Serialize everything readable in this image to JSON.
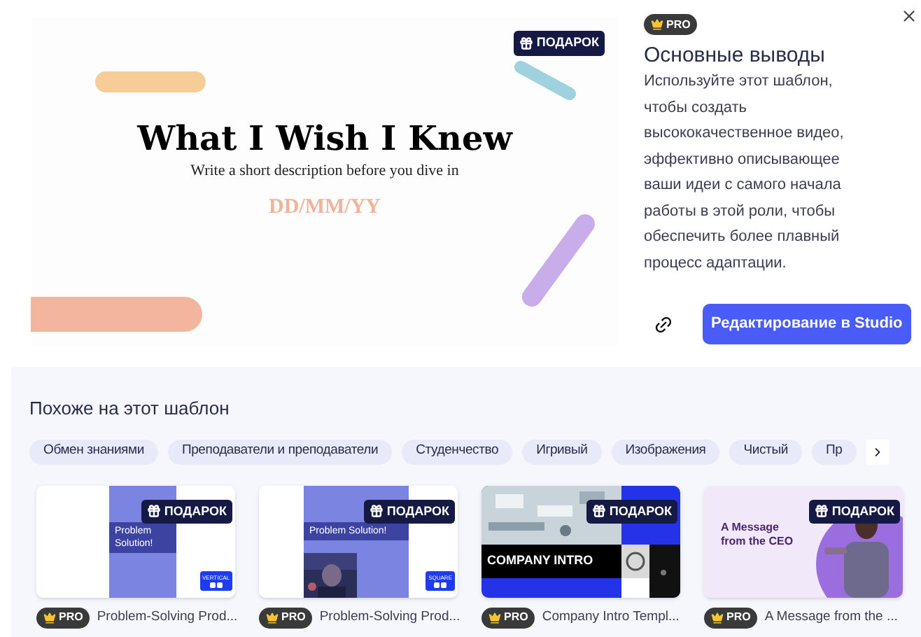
{
  "preview": {
    "badge": "ПОДАРОК",
    "title": "What I Wish I Knew",
    "subtitle": "Write a short description before you dive in",
    "date": "DD/MM/YY"
  },
  "details": {
    "tier": "PRO",
    "title": "Основные выводы",
    "description": "Используйте этот шаблон, чтобы создать высококачественное видео, эффективно описывающее ваши идеи с самого начала работы в этой роли, чтобы обеспечить более плавный процесс адаптации.",
    "edit_button": "Редактирование в Studio"
  },
  "similar": {
    "heading": "Похоже на этот шаблон",
    "tags": [
      "Обмен знаниями",
      "Преподаватели и преподаватели",
      "Студенчество",
      "Игривый",
      "Изображения",
      "Чистый",
      "Пр"
    ],
    "templates": [
      {
        "kind": "problem",
        "thumbnail_text": "Problem Solution!",
        "format": "VERTICAL",
        "badge": "ПОДАРОК",
        "tier": "PRO",
        "name": "Problem-Solving Prod..."
      },
      {
        "kind": "problem-photo",
        "thumbnail_text": "Problem Solution!",
        "format": "SQUARE",
        "badge": "ПОДАРОК",
        "tier": "PRO",
        "name": "Problem-Solving Prod..."
      },
      {
        "kind": "company",
        "thumbnail_text": "COMPANY INTRO",
        "badge": "ПОДАРОК",
        "tier": "PRO",
        "name": "Company Intro Templ..."
      },
      {
        "kind": "ceo",
        "thumbnail_text": "A Message from the CEO",
        "badge": "ПОДАРОК",
        "tier": "PRO",
        "name": "A Message from the ..."
      }
    ]
  }
}
